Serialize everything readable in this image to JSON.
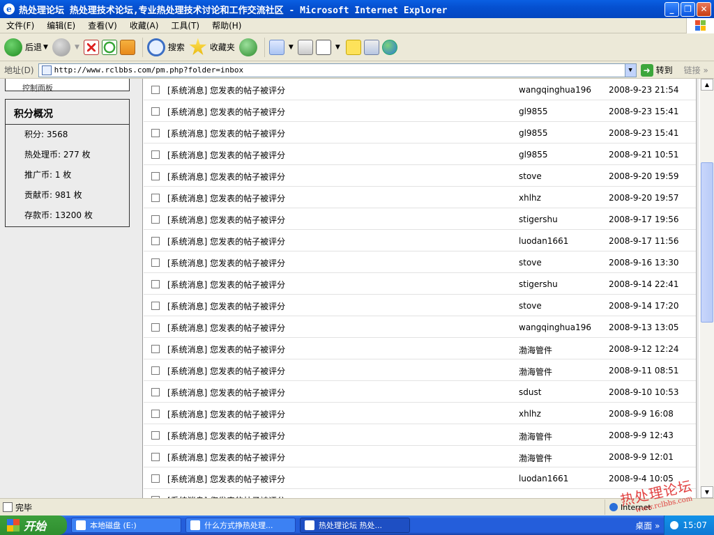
{
  "window": {
    "title": "热处理论坛 热处理技术论坛,专业热处理技术讨论和工作交流社区 - Microsoft Internet Explorer",
    "min_label": "_",
    "max_label": "❐",
    "close_label": "✕"
  },
  "menu": [
    "文件(F)",
    "编辑(E)",
    "查看(V)",
    "收藏(A)",
    "工具(T)",
    "帮助(H)"
  ],
  "toolbar": {
    "back_label": "后退",
    "search_label": "搜索",
    "favorites_label": "收藏夹"
  },
  "address": {
    "label": "地址(D)",
    "url": "http://www.rclbbs.com/pm.php?folder=inbox",
    "go_label": "转到",
    "links_label": "链接"
  },
  "sidebar": {
    "prev_box_text": "控制面板",
    "score_title": "积分概况",
    "items": [
      "积分: 3568",
      "热处理币: 277 枚",
      "推广币: 1 枚",
      "贡献币: 981 枚",
      "存款币: 13200 枚"
    ]
  },
  "messages": [
    {
      "subject": "[系统消息] 您发表的帖子被评分",
      "from": "wangqinghua196",
      "date": "2008-9-23 21:54"
    },
    {
      "subject": "[系统消息] 您发表的帖子被评分",
      "from": "gl9855",
      "date": "2008-9-23 15:41"
    },
    {
      "subject": "[系统消息] 您发表的帖子被评分",
      "from": "gl9855",
      "date": "2008-9-23 15:41"
    },
    {
      "subject": "[系统消息] 您发表的帖子被评分",
      "from": "gl9855",
      "date": "2008-9-21 10:51"
    },
    {
      "subject": "[系统消息] 您发表的帖子被评分",
      "from": "stove",
      "date": "2008-9-20 19:59"
    },
    {
      "subject": "[系统消息] 您发表的帖子被评分",
      "from": "xhlhz",
      "date": "2008-9-20 19:57"
    },
    {
      "subject": "[系统消息] 您发表的帖子被评分",
      "from": "stigershu",
      "date": "2008-9-17 19:56"
    },
    {
      "subject": "[系统消息] 您发表的帖子被评分",
      "from": "luodan1661",
      "date": "2008-9-17 11:56"
    },
    {
      "subject": "[系统消息] 您发表的帖子被评分",
      "from": "stove",
      "date": "2008-9-16 13:30"
    },
    {
      "subject": "[系统消息] 您发表的帖子被评分",
      "from": "stigershu",
      "date": "2008-9-14 22:41"
    },
    {
      "subject": "[系统消息] 您发表的帖子被评分",
      "from": "stove",
      "date": "2008-9-14 17:20"
    },
    {
      "subject": "[系统消息] 您发表的帖子被评分",
      "from": "wangqinghua196",
      "date": "2008-9-13 13:05"
    },
    {
      "subject": "[系统消息] 您发表的帖子被评分",
      "from": "渤海管件",
      "date": "2008-9-12 12:24"
    },
    {
      "subject": "[系统消息] 您发表的帖子被评分",
      "from": "渤海管件",
      "date": "2008-9-11 08:51"
    },
    {
      "subject": "[系统消息] 您发表的帖子被评分",
      "from": "sdust",
      "date": "2008-9-10 10:53"
    },
    {
      "subject": "[系统消息] 您发表的帖子被评分",
      "from": "xhlhz",
      "date": "2008-9-9 16:08"
    },
    {
      "subject": "[系统消息] 您发表的帖子被评分",
      "from": "渤海管件",
      "date": "2008-9-9 12:43"
    },
    {
      "subject": "[系统消息] 您发表的帖子被评分",
      "from": "渤海管件",
      "date": "2008-9-9 12:01"
    },
    {
      "subject": "[系统消息] 您发表的帖子被评分",
      "from": "luodan1661",
      "date": "2008-9-4 10:05"
    },
    {
      "subject": "[系统消息] 您发表的帖子被评分",
      "from": "",
      "date": ""
    }
  ],
  "status": {
    "text": "完毕",
    "zone": "Internet"
  },
  "watermark": {
    "text": "热处理论坛",
    "url": "www.rclbbs.com"
  },
  "taskbar": {
    "start_label": "开始",
    "tasks": [
      "本地磁盘 (E:)",
      "什么方式挣热处理...",
      "热处理论坛 热处..."
    ],
    "desktop_label": "桌面",
    "clock": "15:07"
  },
  "colors": {
    "titlebar": "#0a5fe3",
    "taskbar": "#245edb",
    "start": "#2f8f2f",
    "scroll_thumb": "#c1d3fb"
  }
}
